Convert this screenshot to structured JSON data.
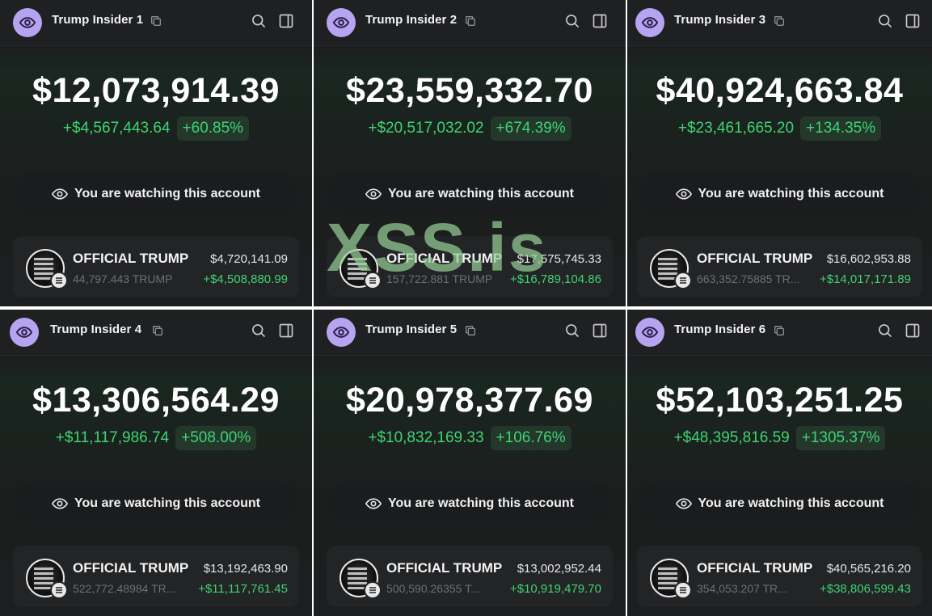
{
  "watermark": "XSS.is",
  "panels": [
    {
      "account_name": "Trump Insider 1",
      "balance": "$12,073,914.39",
      "pnl_abs": "+$4,567,443.64",
      "pnl_pct": "+60.85%",
      "watch_text": "You are watching this account",
      "token": {
        "name": "OFFICIAL TRUMP",
        "value": "$4,720,141.09",
        "qty": "44,797.443 TRUMP",
        "pnl": "+$4,508,880.99"
      }
    },
    {
      "account_name": "Trump Insider 2",
      "balance": "$23,559,332.70",
      "pnl_abs": "+$20,517,032.02",
      "pnl_pct": "+674.39%",
      "watch_text": "You are watching this account",
      "token": {
        "name": "OFFICIAL TRUMP",
        "value": "$17,575,745.33",
        "qty": "157,722.881 TRUMP",
        "pnl": "+$16,789,104.86"
      }
    },
    {
      "account_name": "Trump Insider 3",
      "balance": "$40,924,663.84",
      "pnl_abs": "+$23,461,665.20",
      "pnl_pct": "+134.35%",
      "watch_text": "You are watching this account",
      "token": {
        "name": "OFFICIAL TRUMP",
        "value": "$16,602,953.88",
        "qty": "663,352.75885 TR...",
        "pnl": "+$14,017,171.89"
      }
    },
    {
      "account_name": "Trump Insider 4",
      "balance": "$13,306,564.29",
      "pnl_abs": "+$11,117,986.74",
      "pnl_pct": "+508.00%",
      "watch_text": "You are watching this account",
      "token": {
        "name": "OFFICIAL TRUMP",
        "value": "$13,192,463.90",
        "qty": "522,772.48984 TR...",
        "pnl": "+$11,117,761.45"
      }
    },
    {
      "account_name": "Trump Insider 5",
      "balance": "$20,978,377.69",
      "pnl_abs": "+$10,832,169.33",
      "pnl_pct": "+106.76%",
      "watch_text": "You are watching this account",
      "token": {
        "name": "OFFICIAL TRUMP",
        "value": "$13,002,952.44",
        "qty": "500,590.26355 T...",
        "pnl": "+$10,919,479.70"
      }
    },
    {
      "account_name": "Trump Insider 6",
      "balance": "$52,103,251.25",
      "pnl_abs": "+$48,395,816.59",
      "pnl_pct": "+1305.37%",
      "watch_text": "You are watching this account",
      "token": {
        "name": "OFFICIAL TRUMP",
        "value": "$40,565,216.20",
        "qty": "354,053.207 TR...",
        "pnl": "+$38,806,599.43"
      }
    }
  ],
  "colors": {
    "accent_green": "#3fd373",
    "avatar_purple": "#b7a4f0",
    "background": "#1c1d1f"
  },
  "icons": {
    "avatar": "eye-icon",
    "copy": "copy-icon",
    "search": "search-icon",
    "panel": "sidebar-toggle-icon",
    "watch": "eye-icon",
    "chain": "solana-icon"
  }
}
